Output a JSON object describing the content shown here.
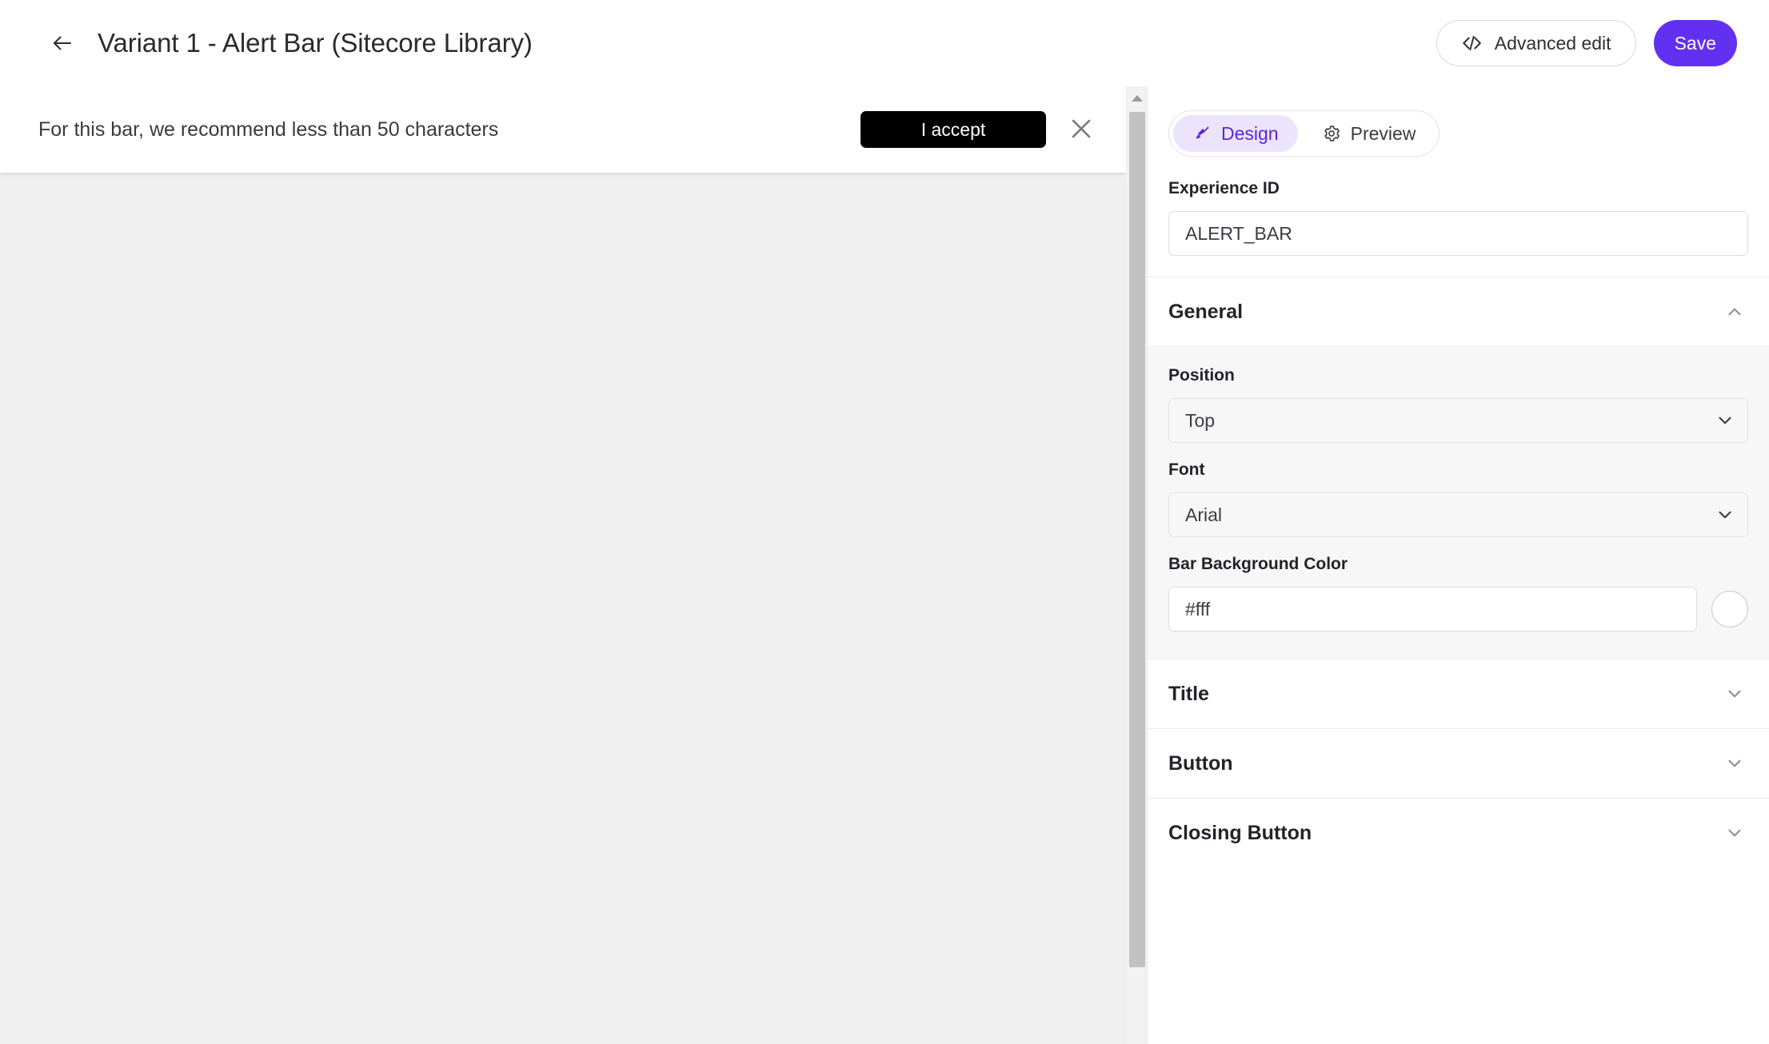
{
  "header": {
    "back_icon": "arrow-left-icon",
    "title": "Variant 1 - Alert Bar (Sitecore Library)",
    "advanced_edit_label": "Advanced edit",
    "advanced_edit_icon": "code-icon",
    "save_label": "Save",
    "save_color": "#6230f0"
  },
  "preview": {
    "alert_text": "For this bar, we recommend less than 50 characters",
    "accept_button_label": "I accept",
    "accept_button_bg": "#000000",
    "accept_button_color": "#ffffff",
    "close_icon": "close-icon",
    "canvas_bg": "#efefef",
    "bar_bg": "#ffffff",
    "scrollbar": {
      "up_arrow_icon": "scroll-up-arrow-icon",
      "thumb_color": "#c1c1c1",
      "track_color": "#f2f2f2"
    }
  },
  "panel": {
    "tabs": [
      {
        "label": "Design",
        "icon": "brush-icon",
        "active": true
      },
      {
        "label": "Preview",
        "icon": "gear-icon",
        "active": false
      }
    ],
    "tab_active_bg": "#ece4fd",
    "tab_active_color": "#5a26d6",
    "experience_id": {
      "label": "Experience ID",
      "value": "ALERT_BAR",
      "placeholder": "Experience ID"
    },
    "sections": [
      {
        "title": "General",
        "expanded": true,
        "chevron_icon": "chevron-up-icon",
        "fields": {
          "position": {
            "label": "Position",
            "value": "Top",
            "chevron_icon": "chevron-down-icon"
          },
          "font": {
            "label": "Font",
            "value": "Arial",
            "chevron_icon": "chevron-down-icon"
          },
          "bar_background_color": {
            "label": "Bar Background Color",
            "value": "#fff",
            "placeholder": "#fff",
            "swatch_color": "#ffffff"
          }
        }
      },
      {
        "title": "Title",
        "expanded": false,
        "chevron_icon": "chevron-down-icon"
      },
      {
        "title": "Button",
        "expanded": false,
        "chevron_icon": "chevron-down-icon"
      },
      {
        "title": "Closing Button",
        "expanded": false,
        "chevron_icon": "chevron-down-icon"
      }
    ]
  }
}
